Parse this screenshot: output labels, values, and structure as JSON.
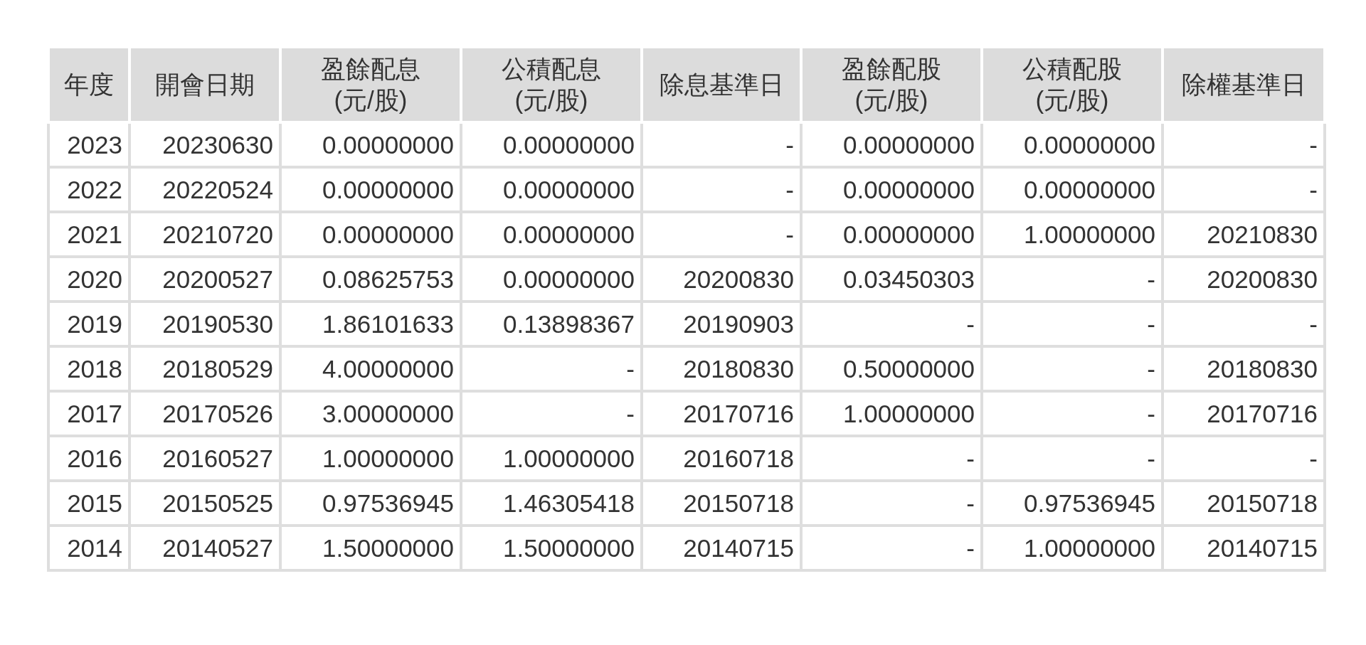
{
  "table": {
    "columns": [
      {
        "lines": [
          "年度"
        ]
      },
      {
        "lines": [
          "開會日期"
        ]
      },
      {
        "lines": [
          "盈餘配息",
          "(元/股)"
        ]
      },
      {
        "lines": [
          "公積配息",
          "(元/股)"
        ]
      },
      {
        "lines": [
          "除息基準日"
        ]
      },
      {
        "lines": [
          "盈餘配股",
          "(元/股)"
        ]
      },
      {
        "lines": [
          "公積配股",
          "(元/股)"
        ]
      },
      {
        "lines": [
          "除權基準日"
        ]
      }
    ],
    "rows": [
      [
        "2023",
        "20230630",
        "0.00000000",
        "0.00000000",
        "-",
        "0.00000000",
        "0.00000000",
        "-"
      ],
      [
        "2022",
        "20220524",
        "0.00000000",
        "0.00000000",
        "-",
        "0.00000000",
        "0.00000000",
        "-"
      ],
      [
        "2021",
        "20210720",
        "0.00000000",
        "0.00000000",
        "-",
        "0.00000000",
        "1.00000000",
        "20210830"
      ],
      [
        "2020",
        "20200527",
        "0.08625753",
        "0.00000000",
        "20200830",
        "0.03450303",
        "-",
        "20200830"
      ],
      [
        "2019",
        "20190530",
        "1.86101633",
        "0.13898367",
        "20190903",
        "-",
        "-",
        "-"
      ],
      [
        "2018",
        "20180529",
        "4.00000000",
        "-",
        "20180830",
        "0.50000000",
        "-",
        "20180830"
      ],
      [
        "2017",
        "20170526",
        "3.00000000",
        "-",
        "20170716",
        "1.00000000",
        "-",
        "20170716"
      ],
      [
        "2016",
        "20160527",
        "1.00000000",
        "1.00000000",
        "20160718",
        "-",
        "-",
        "-"
      ],
      [
        "2015",
        "20150525",
        "0.97536945",
        "1.46305418",
        "20150718",
        "-",
        "0.97536945",
        "20150718"
      ],
      [
        "2014",
        "20140527",
        "1.50000000",
        "1.50000000",
        "20140715",
        "-",
        "1.00000000",
        "20140715"
      ]
    ]
  }
}
